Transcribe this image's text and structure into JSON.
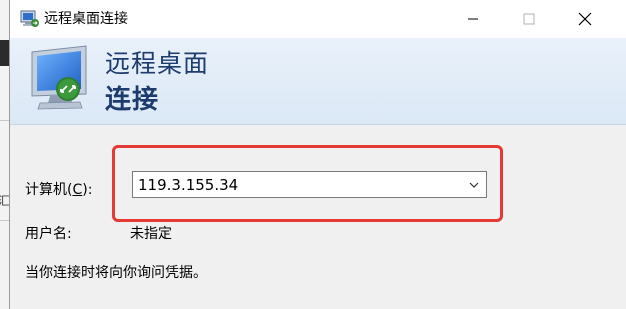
{
  "window": {
    "title": "远程桌面连接",
    "minimize_symbol": "─",
    "maximize_symbol": "☐",
    "close_symbol": "✕"
  },
  "banner": {
    "line1": "远程桌面",
    "line2": "连接"
  },
  "form": {
    "computer_label_prefix": "计算机(",
    "computer_label_key": "C",
    "computer_label_suffix": "):",
    "computer_value": "119.3.155.34",
    "username_label": "用户名:",
    "username_value": "未指定",
    "info": "当你连接时将向你询问凭据。"
  },
  "background": {
    "partial_glyph": "汇"
  },
  "colors": {
    "highlight": "#e53935",
    "banner_text": "#1e3b6e",
    "banner_bg": "#dbe8f6"
  },
  "icons": {
    "title": "remote-desktop-icon",
    "banner": "remote-desktop-monitor-icon",
    "combo": "chevron-down-icon"
  }
}
